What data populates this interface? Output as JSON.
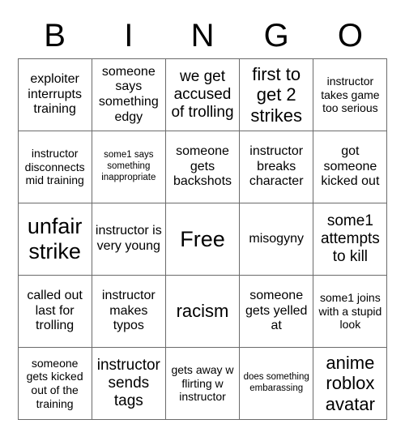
{
  "card": {
    "title": "BINGO",
    "header_letters": [
      "B",
      "I",
      "N",
      "G",
      "O"
    ],
    "colors": {
      "background": "#ffffff",
      "text": "#000000",
      "grid_line": "#6b6b6b"
    },
    "grid_size": "5x5",
    "free_space_label": "Free",
    "rows": [
      [
        {
          "text": "exploiter interrupts training",
          "size": "md"
        },
        {
          "text": "someone says something edgy",
          "size": "md"
        },
        {
          "text": "we get accused of trolling",
          "size": "lg"
        },
        {
          "text": "first to get 2 strikes",
          "size": "xl"
        },
        {
          "text": "instructor takes game too serious",
          "size": "sm"
        }
      ],
      [
        {
          "text": "instructor disconnects mid training",
          "size": "sm"
        },
        {
          "text": "some1 says something inappropriate",
          "size": "xs"
        },
        {
          "text": "someone gets backshots",
          "size": "md"
        },
        {
          "text": "instructor breaks character",
          "size": "md"
        },
        {
          "text": "got someone kicked out",
          "size": "md"
        }
      ],
      [
        {
          "text": "unfair strike",
          "size": "xxl"
        },
        {
          "text": "instructor is very young",
          "size": "md"
        },
        {
          "text": "Free",
          "size": "xxl"
        },
        {
          "text": "misogyny",
          "size": "md"
        },
        {
          "text": "some1 attempts to kill",
          "size": "lg"
        }
      ],
      [
        {
          "text": "called out last for trolling",
          "size": "md"
        },
        {
          "text": "instructor makes typos",
          "size": "md"
        },
        {
          "text": "racism",
          "size": "xl"
        },
        {
          "text": "someone gets yelled at",
          "size": "md"
        },
        {
          "text": "some1 joins with a stupid look",
          "size": "sm"
        }
      ],
      [
        {
          "text": "someone gets kicked out of the training",
          "size": "sm"
        },
        {
          "text": "instructor sends tags",
          "size": "lg"
        },
        {
          "text": "gets away w flirting w instructor",
          "size": "sm"
        },
        {
          "text": "does something embarassing",
          "size": "xs"
        },
        {
          "text": "anime roblox avatar",
          "size": "xl"
        }
      ]
    ]
  }
}
